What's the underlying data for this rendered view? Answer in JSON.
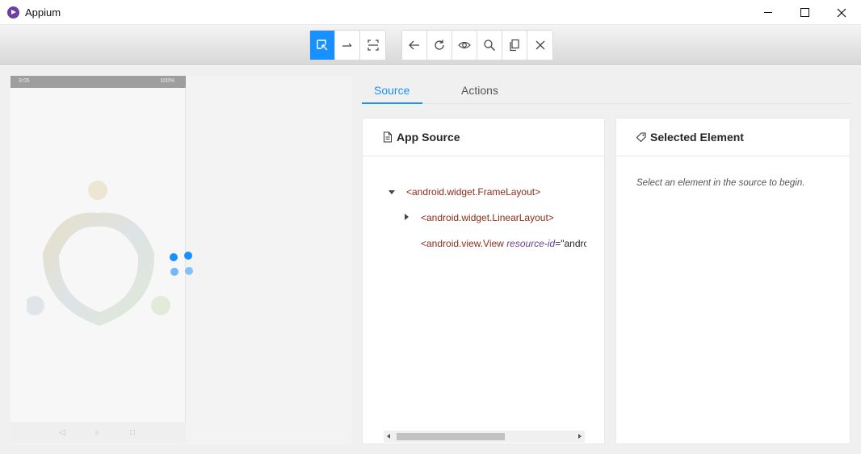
{
  "window": {
    "title": "Appium",
    "controls": {
      "minimize_icon": "minimize-icon",
      "maximize_icon": "maximize-icon",
      "close_icon": "close-icon"
    }
  },
  "toolbar": {
    "group1": [
      "select-elements-icon",
      "swipe-icon",
      "tap-region-icon"
    ],
    "group2": [
      "back-icon",
      "refresh-icon",
      "eye-icon",
      "search-icon",
      "copy-xml-icon",
      "quit-session-icon"
    ],
    "active": "select-elements-icon",
    "accent": "#1890ff"
  },
  "device": {
    "status_time": "3:05",
    "status_right": "100%",
    "nav": [
      "◁",
      "○",
      "□"
    ]
  },
  "tabs": [
    {
      "label": "Source",
      "active": true
    },
    {
      "label": "Actions",
      "active": false
    }
  ],
  "source_panel": {
    "title": "App Source",
    "tree": [
      {
        "tag": "<android.widget.FrameLayout>",
        "expanded": true
      },
      {
        "tag": "<android.widget.LinearLayout>",
        "expanded": false
      },
      {
        "tag": "<android.view.View",
        "attr": "resource-id",
        "value": "=\"andrc"
      }
    ]
  },
  "selected_panel": {
    "title": "Selected Element",
    "hint": "Select an element in the source to begin."
  }
}
